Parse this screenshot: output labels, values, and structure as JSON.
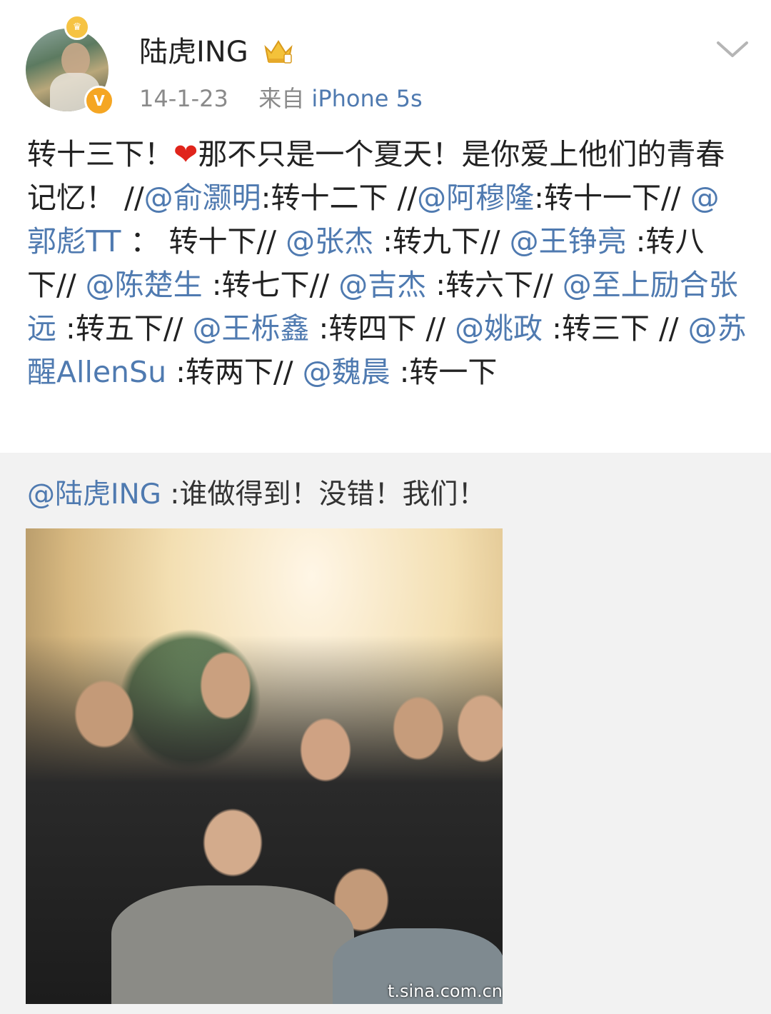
{
  "header": {
    "username": "陆虎ING",
    "date": "14-1-23",
    "source_prefix": "来自",
    "device": "iPhone 5s",
    "avatar_icon": "avatar-photo",
    "verified_icon": "verified-v-icon",
    "crown_icon": "crown-icon",
    "member_icon": "vip-crown-icon",
    "menu_icon": "chevron-down-icon"
  },
  "post": {
    "segments": [
      {
        "type": "text",
        "text": "转十三下！"
      },
      {
        "type": "heart",
        "text": "❤"
      },
      {
        "type": "text",
        "text": "那不只是一个夏天！是你爱上他们的青春记忆！ //"
      },
      {
        "type": "mention",
        "text": "@俞灏明"
      },
      {
        "type": "text",
        "text": ":转十二下 //"
      },
      {
        "type": "mention",
        "text": "@阿穆隆"
      },
      {
        "type": "text",
        "text": ":转十一下// "
      },
      {
        "type": "mention",
        "text": "@郭彪TT"
      },
      {
        "type": "text",
        "text": " ： 转十下// "
      },
      {
        "type": "mention",
        "text": "@张杰"
      },
      {
        "type": "text",
        "text": " :转九下// "
      },
      {
        "type": "mention",
        "text": "@王铮亮"
      },
      {
        "type": "text",
        "text": " :转八下// "
      },
      {
        "type": "mention",
        "text": "@陈楚生"
      },
      {
        "type": "text",
        "text": " :转七下// "
      },
      {
        "type": "mention",
        "text": "@吉杰"
      },
      {
        "type": "text",
        "text": " :转六下// "
      },
      {
        "type": "mention",
        "text": "@至上励合张远"
      },
      {
        "type": "text",
        "text": " :转五下// "
      },
      {
        "type": "mention",
        "text": "@王栎鑫"
      },
      {
        "type": "text",
        "text": " :转四下 // "
      },
      {
        "type": "mention",
        "text": "@姚政"
      },
      {
        "type": "text",
        "text": " :转三下 // "
      },
      {
        "type": "mention",
        "text": "@苏醒AllenSu"
      },
      {
        "type": "text",
        "text": " :转两下// "
      },
      {
        "type": "mention",
        "text": "@魏晨"
      },
      {
        "type": "text",
        "text": " :转一下"
      }
    ]
  },
  "repost": {
    "mention": "@陆虎ING",
    "text": " :谁做得到！没错！我们！",
    "watermark": "t.sina.com.cn"
  },
  "colors": {
    "link": "#4f7ab0",
    "meta": "#8a8a8a",
    "repost_bg": "#f2f2f2",
    "heart": "#e0241b"
  }
}
